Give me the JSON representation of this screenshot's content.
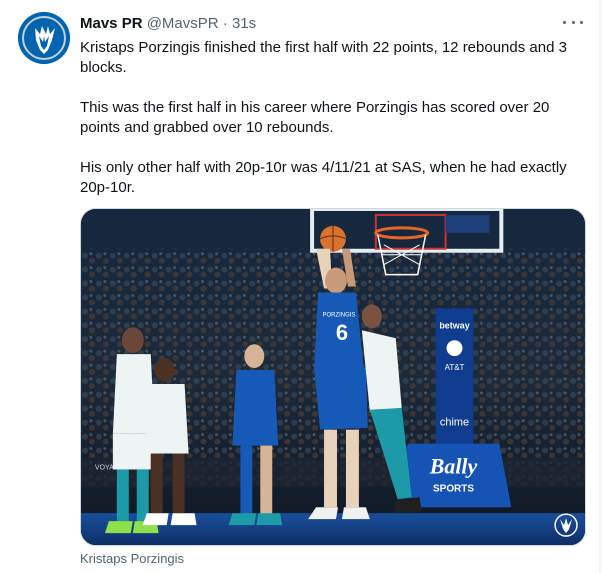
{
  "tweet": {
    "author_name": "Mavs PR",
    "handle": "@MavsPR",
    "separator": "·",
    "time": "31s",
    "paragraphs": [
      "Kristaps Porzingis finished the first half with 22 points, 12 rebounds and 3 blocks.",
      "This was the first half in his career where Porzingis has scored over 20 points and grabbed over 10 rebounds.",
      "His only other half with 20p-10r was 4/11/21 at SAS, when he had exactly 20p-10r."
    ],
    "media_caption": "Kristaps Porzingis",
    "icons": {
      "avatar": "mavericks-logo",
      "more": "more-options-icon"
    }
  },
  "photo": {
    "jersey_number": "6",
    "jersey_name": "PORZINGIS",
    "sponsor_betway": "betway",
    "sponsor_att": "AT&T",
    "sponsor_chime": "chime",
    "sponsor_bally": "Bally",
    "sponsor_sports": "SPORTS",
    "sponsor_voyager": "VOYAGER"
  },
  "colors": {
    "text_primary": "#0f1419",
    "text_secondary": "#536471",
    "mavs_blue": "#0064b1",
    "hornets_teal": "#1d9aa7"
  }
}
